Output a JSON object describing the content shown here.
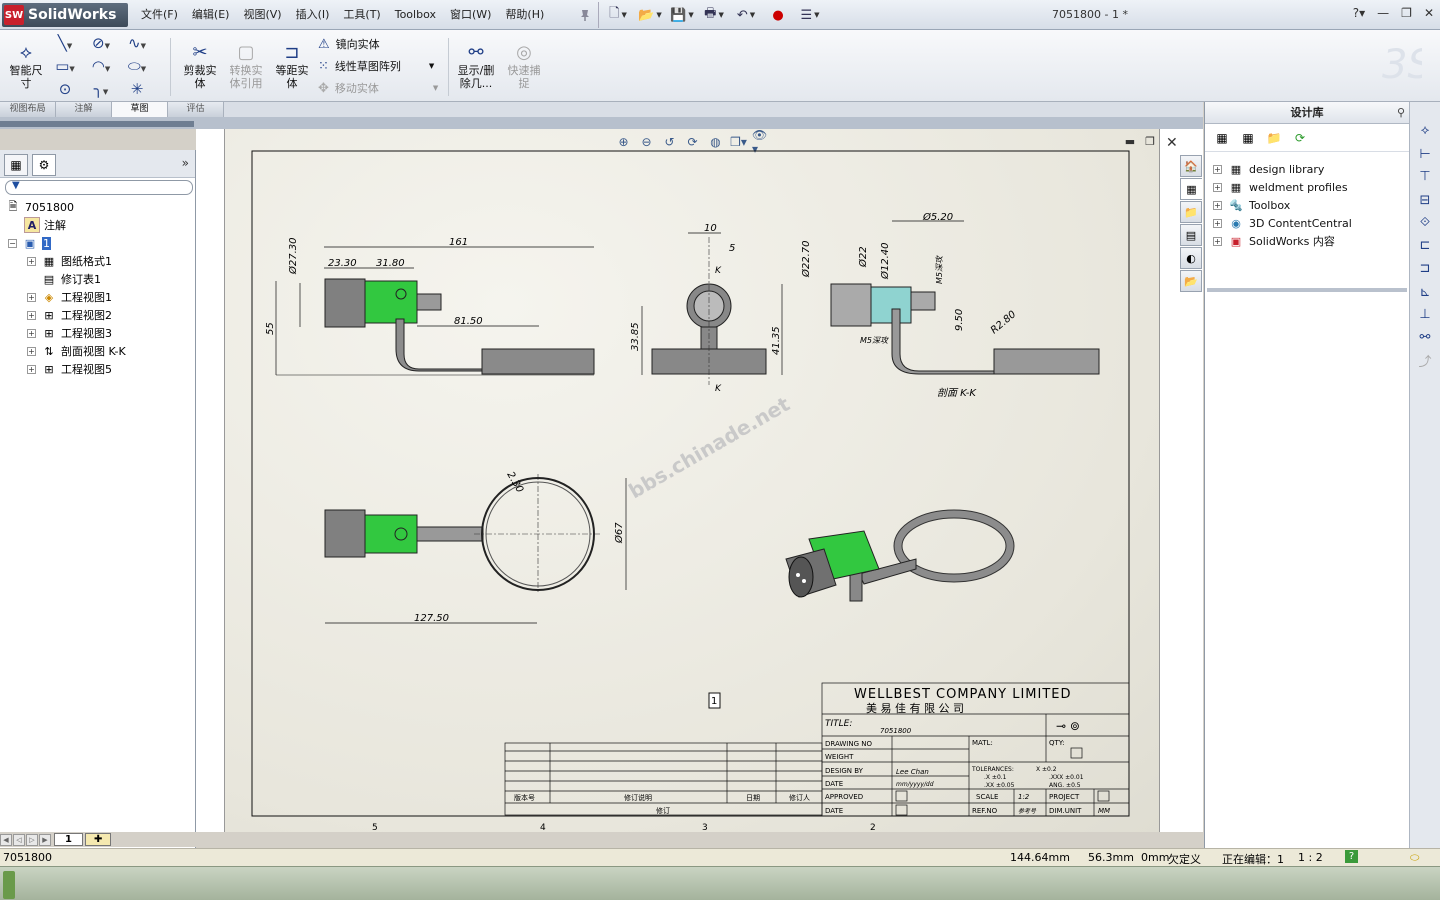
{
  "app": {
    "logo_badge": "SW",
    "logo_text": "SolidWorks",
    "doc_title": "7051800 - 1 *"
  },
  "menu": [
    "文件(F)",
    "编辑(E)",
    "视图(V)",
    "插入(I)",
    "工具(T)",
    "Toolbox",
    "窗口(W)",
    "帮助(H)"
  ],
  "commands": {
    "smart_dim": "智能尺寸",
    "trim": "剪裁实体",
    "convert": "转换实体引用",
    "offset": "等距实体",
    "mirror": "镜向实体",
    "linear_pattern": "线性草图阵列",
    "move": "移动实体",
    "show_delete": "显示/删除几...",
    "quick_snap": "快速捕捉"
  },
  "cmd_tabs": [
    "视图布局",
    "注解",
    "草图",
    "评估"
  ],
  "active_cmd_tab": "草图",
  "tree": {
    "root": "7051800",
    "annotations": "注解",
    "sheet": "1",
    "items": [
      "图纸格式1",
      "修订表1",
      "工程视图1",
      "工程视图2",
      "工程视图3",
      "剖面视图 K-K",
      "工程视图5"
    ]
  },
  "sheet_tab": "1",
  "taskpane": {
    "title": "设计库",
    "items": [
      "design library",
      "weldment profiles",
      "Toolbox",
      "3D ContentCentral",
      "SolidWorks 内容"
    ]
  },
  "drawing": {
    "dims_front": [
      "Ø27.30",
      "23.30",
      "31.80",
      "161",
      "55",
      "81.50"
    ],
    "dims_side": [
      "10",
      "5",
      "K",
      "33.85",
      "41.35",
      "K"
    ],
    "dims_section": [
      "Ø5.20",
      "Ø22.70",
      "Ø22",
      "Ø12.40",
      "M5深攻",
      "M5深攻",
      "9.50",
      "R2.80"
    ],
    "section_label": "剖面 K-K",
    "dims_top": [
      "2.30",
      "Ø67",
      "127.50"
    ],
    "watermark": "bbs.chinade.net",
    "balloon": "1",
    "zone_numbers": [
      "5",
      "4",
      "3",
      "2"
    ],
    "title_block": {
      "company": "WELLBEST COMPANY LIMITED",
      "company_cn": "美 易 佳 有 限 公 司",
      "title_label": "TITLE:",
      "title_value": "7051800",
      "drawing_no": "DRAWING NO",
      "weight": "WEIGHT",
      "design_by": "DESIGN BY",
      "design_value": "Lee Chan",
      "date": "DATE",
      "date_value": "mm/yyyy/dd",
      "approved": "APPROVED",
      "matl": "MATL:",
      "qty": "QTY:",
      "tolerances": "TOLERANCES:",
      "tol_x": "X ±0.2",
      "tol_x1": ".X ±0.1",
      "tol_xxx": ".XXX ±0.01",
      "tol_xx": ".XX ±0.05",
      "tol_ang": "ANG. ±0.5",
      "scale_label": "SCALE",
      "scale_value": "1:2",
      "project": "PROJECT",
      "refno": "REF.NO",
      "refno_value": "参考号",
      "dimunit": "DIM.UNIT",
      "dimunit_value": "MM"
    },
    "revision_headers": [
      "版本号",
      "修订说明",
      "日期",
      "修订人"
    ],
    "revision_title": "修订"
  },
  "status": {
    "filename": "7051800",
    "x": "144.64mm",
    "y": "56.3mm",
    "z": "0mm",
    "state": "欠定义",
    "editing": "正在编辑：1",
    "scale": "1 : 2"
  },
  "colors": {
    "accent": "#1f3e86",
    "green_part": "#2ecc40",
    "selection": "#3169c6"
  }
}
